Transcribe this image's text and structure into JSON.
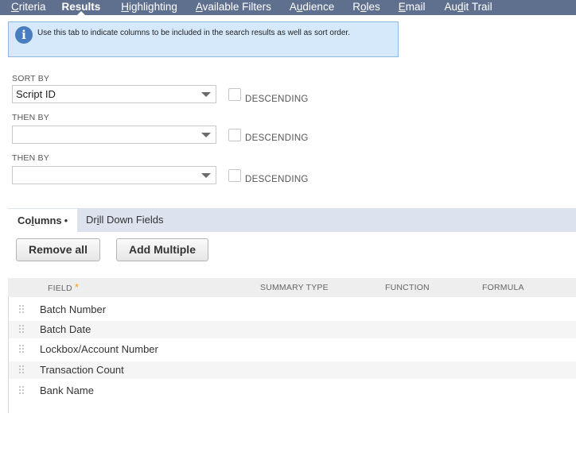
{
  "tabs": [
    {
      "pre": "",
      "ul": "C",
      "post": "riteria"
    },
    {
      "pre": "",
      "ul": "",
      "post": "Results"
    },
    {
      "pre": "",
      "ul": "H",
      "post": "ighlighting"
    },
    {
      "pre": "",
      "ul": "A",
      "post": "vailable Filters"
    },
    {
      "pre": "A",
      "ul": "u",
      "post": "dience"
    },
    {
      "pre": "R",
      "ul": "o",
      "post": "les"
    },
    {
      "pre": "",
      "ul": "E",
      "post": "mail"
    },
    {
      "pre": "Au",
      "ul": "d",
      "post": "it Trail"
    }
  ],
  "active_tab": "Results",
  "info": {
    "icon": "info-icon",
    "text": "Use this tab to indicate columns to be included in the search results as well as sort order."
  },
  "sort": {
    "sort_by_label": "SORT BY",
    "sort_by_value": "Script ID",
    "then_by_label_1": "THEN BY",
    "then_by_value_1": "",
    "then_by_label_2": "THEN BY",
    "then_by_value_2": "",
    "descending_label": "DESCENDING"
  },
  "subtabs": {
    "columns_pre": "Co",
    "columns_ul": "l",
    "columns_post": "umns",
    "columns_dot": "•",
    "drill_pre": "Dr",
    "drill_ul": "i",
    "drill_post": "ll Down Fields"
  },
  "buttons": {
    "remove_all": "Remove all",
    "add_multiple": "Add Multiple"
  },
  "table": {
    "headers": {
      "field": "FIELD",
      "required_mark": "*",
      "summary_type": "SUMMARY TYPE",
      "function": "FUNCTION",
      "formula": "FORMULA"
    },
    "rows": [
      "Batch Number",
      "Batch Date",
      "Lockbox/Account Number",
      "Transaction Count",
      "Bank Name"
    ]
  },
  "colors": {
    "tab_bar": "#5f6f8e",
    "info_bg": "#d5e9fb",
    "info_icon": "#4a7dc0",
    "subtab_bar": "#dde3ee",
    "required": "#f0a21a"
  }
}
